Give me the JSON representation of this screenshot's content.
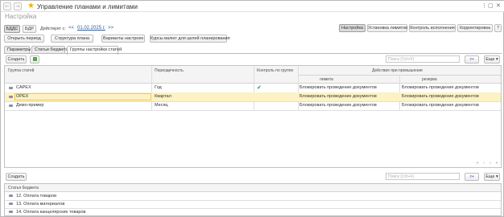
{
  "window": {
    "title": "Управление планами и лимитами",
    "subtitle": "Настройка"
  },
  "toolbar": {
    "bdds": "БДДС",
    "bdr": "БДР",
    "acts_from": "Действует с:",
    "prev": "<<",
    "date": "01.02.2025 г.",
    "next": ">>",
    "right_tabs": [
      "Настройка",
      "Установка лимитов",
      "Контроль исполнения",
      "Корректировка",
      "?"
    ]
  },
  "actions": {
    "open_period": "Открыть период",
    "plan_structure": "Структура плана",
    "setting_variants": "Варианты настроек",
    "currency_rates": "Курсы валют для целей планирования"
  },
  "tabs": [
    "Параметры",
    "Статьи бюджета",
    "Группы настройки статей"
  ],
  "upper": {
    "create": "Создать",
    "search_placeholder": "Поиск (Ctrl+F)",
    "more": "Еще",
    "headers": {
      "group": "Группа статей",
      "periodicity": "Периодичность",
      "control": "Контроль по группе",
      "action": "Действие при превышении",
      "limit": "лимита",
      "reserve": "резерва"
    },
    "rows": [
      {
        "group": "CAPEX",
        "periodicity": "Год",
        "checked": true,
        "limit": "Блокировать проведение документов",
        "reserve": "Блокировать проведение документов"
      },
      {
        "group": "OPEX",
        "periodicity": "Квартал",
        "checked": false,
        "limit": "Блокировать проведение документов",
        "reserve": "Блокировать проведение документов"
      },
      {
        "group": "Демо-пример",
        "periodicity": "Месяц",
        "checked": false,
        "limit": "Блокировать проведение документов",
        "reserve": "Блокировать проведение документов"
      }
    ]
  },
  "lower": {
    "create": "Создать",
    "search_placeholder": "Поиск (Ctrl+F)",
    "more": "Еще",
    "header": "Статья бюджета",
    "rows": [
      {
        "label": "12. Оплата товаров"
      },
      {
        "label": "13. Оплата материалов"
      },
      {
        "label": "14. Оплата канцелярских товаров"
      }
    ]
  },
  "colors": {
    "selected_row": "#fdf2c3",
    "selected_border": "#f0c85a",
    "link": "#2b5c9e",
    "star": "#f0b400"
  }
}
